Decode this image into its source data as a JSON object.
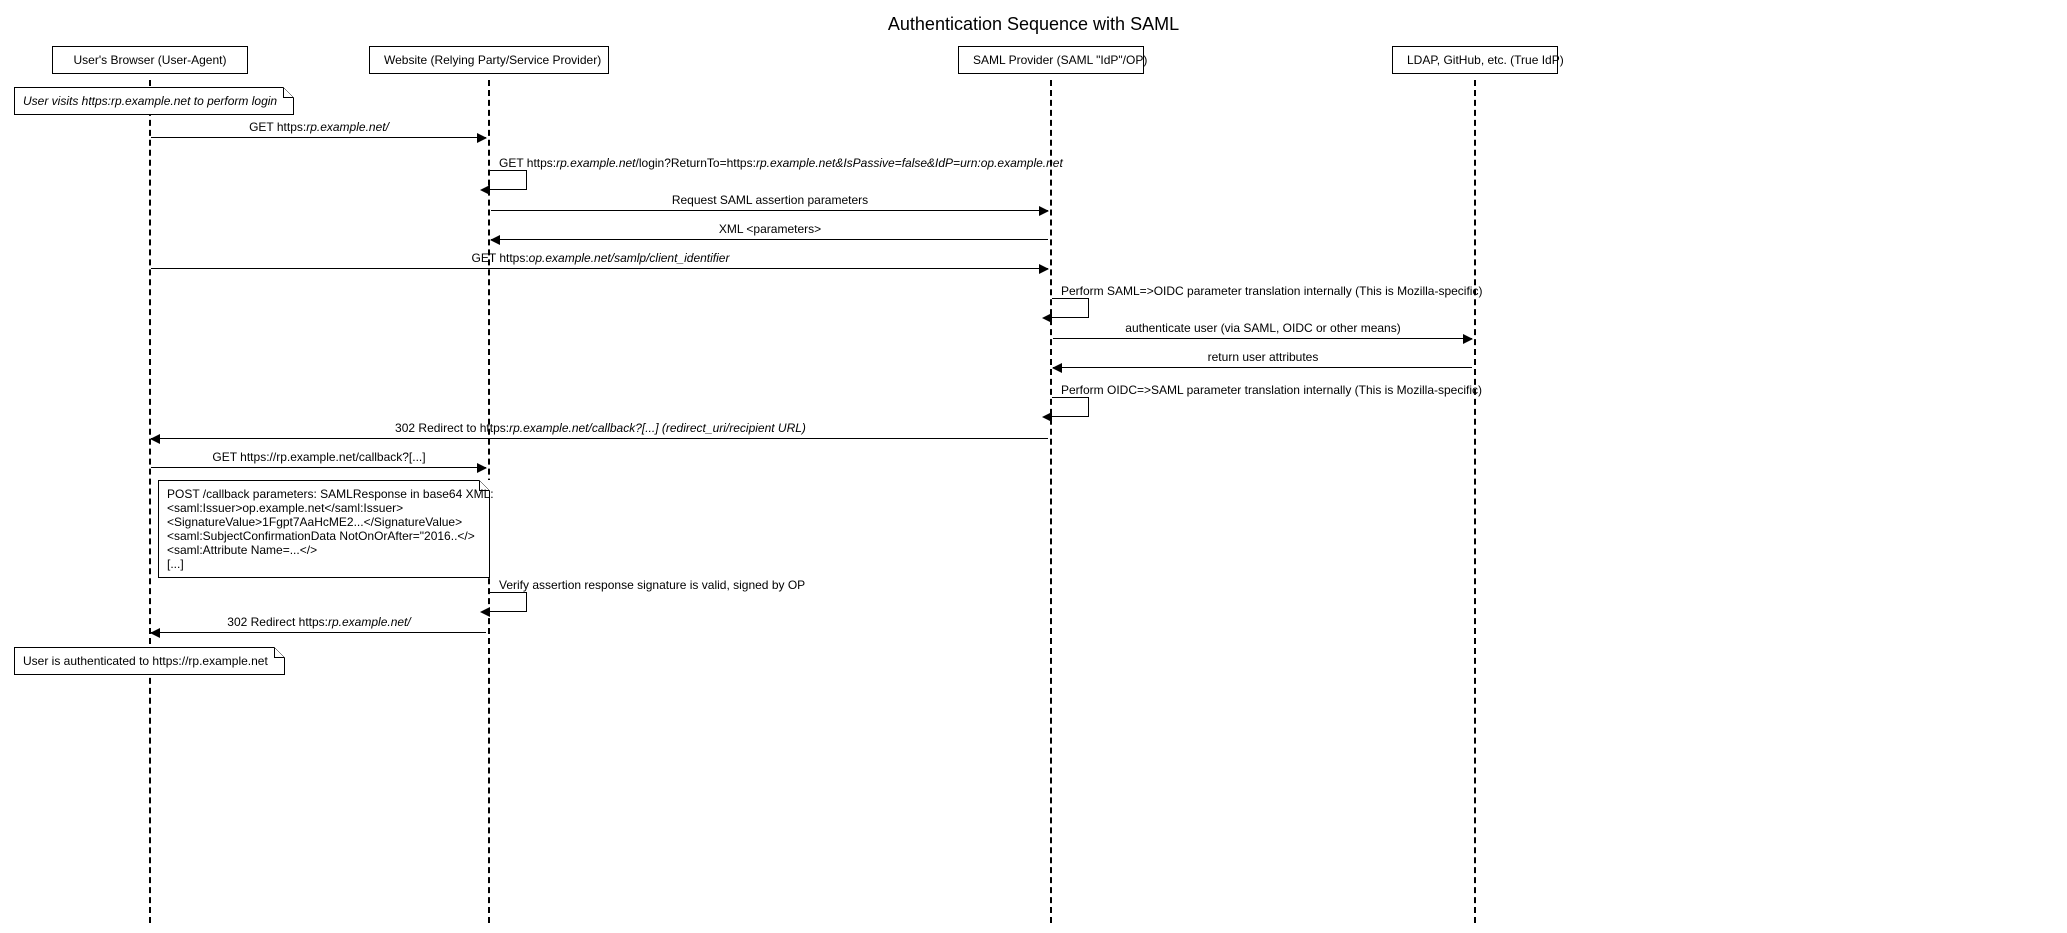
{
  "title": "Authentication Sequence with SAML",
  "participants": {
    "user": "User's Browser (User-Agent)",
    "website": "Website (Relying Party/Service Provider)",
    "saml": "SAML Provider (SAML \"IdP\"/OP)",
    "idp": "LDAP, GitHub, etc. (True IdP)"
  },
  "notes": {
    "n1": "User visits https:rp.example.net to perform login",
    "n2l1": "POST /callback parameters: SAMLResponse in base64 XML:",
    "n2l2": "<saml:Issuer>op.example.net</saml:Issuer>",
    "n2l3": "<SignatureValue>1Fgpt7AaHcME2...</SignatureValue>",
    "n2l4": "<saml:SubjectConfirmationData NotOnOrAfter=\"2016..</>",
    "n2l5": "<saml:Attribute Name=...</>",
    "n2l6": "[...]",
    "n3": "User is authenticated to https://rp.example.net"
  },
  "messages": {
    "m1_a": "GET https:",
    "m1_b": "rp.example.net/",
    "m2_a": "GET https:",
    "m2_b": "rp.example.net",
    "m2_c": "/login?ReturnTo=https:",
    "m2_d": "rp.example.net&IsPassive=false&IdP=urn:op.example.net",
    "m3": "Request SAML assertion parameters",
    "m4": "XML <parameters>",
    "m5_a": "GET https:",
    "m5_b": "op.example.net",
    "m5_c": "/samlp/client_identifier",
    "m6": "Perform SAML=>OIDC parameter translation internally (This is Mozilla-specific)",
    "m7": "authenticate user (via SAML, OIDC or other means)",
    "m8": "return user attributes",
    "m9": "Perform OIDC=>SAML parameter translation internally (This is Mozilla-specific)",
    "m10_a": "302 Redirect to https:",
    "m10_b": "rp.example.net",
    "m10_c": "/callback?[...] (redirect_uri/recipient URL)",
    "m11": "GET https://rp.example.net/callback?[...]",
    "m12": "Verify assertion response signature is valid, signed by OP",
    "m13_a": "302 Redirect https:",
    "m13_b": "rp.example.net/"
  }
}
